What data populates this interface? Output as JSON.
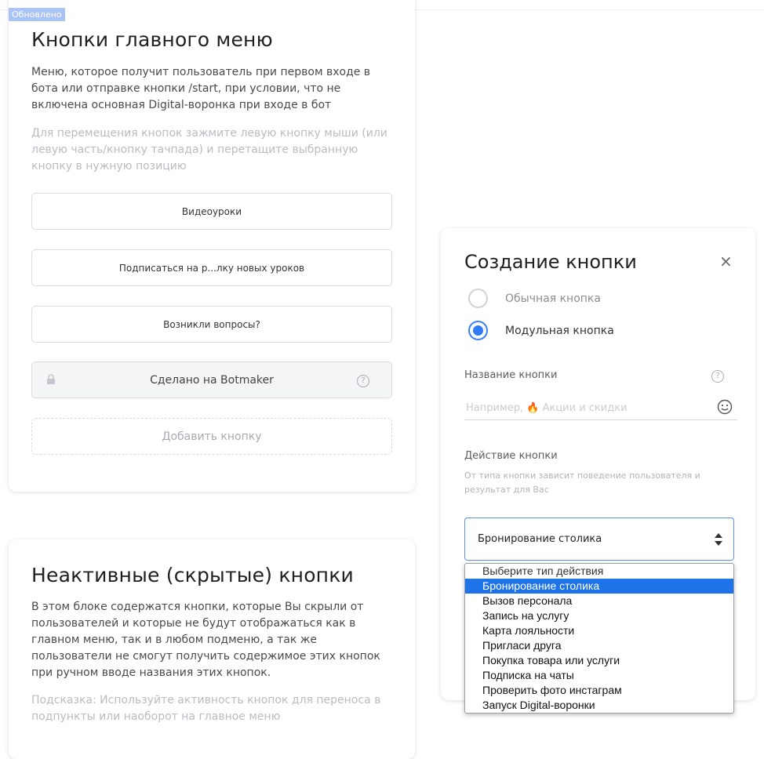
{
  "main_menu": {
    "badge": "Обновлено",
    "title": "Кнопки главного меню",
    "description": "Меню, которое получит пользователь при первом входе в бота или отправке кнопки /start, при условии, что не включена основная Digital-воронка при входе в бот",
    "hint": "Для перемещения кнопок зажмите левую кнопку мыши (или левую часть/кнопку тачпада) и перетащите выбранную кнопку в нужную позицию",
    "buttons": [
      {
        "label": "Видеоуроки"
      },
      {
        "label": "Подписаться на р...лку новых уроков"
      },
      {
        "label": "Возникли вопросы?"
      }
    ],
    "locked_button": {
      "label": "Сделано на Botmaker",
      "help": "?"
    },
    "add_button": "Добавить кнопку"
  },
  "inactive": {
    "title": "Неактивные (скрытые) кнопки",
    "description": "В этом блоке содержатся кнопки, которые Вы скрыли от пользователей и которые не будут отображаться как в главном меню, так и в любом подменю, а так же пользователи не смогут получить содержимое этих кнопок при ручном вводе названия этих кнопок.",
    "hint": "Подсказка: Используйте активность кнопок для переноса в подпункты или наоборот на главное меню"
  },
  "modal": {
    "title": "Создание кнопки",
    "close": "×",
    "radio_regular": "Обычная кнопка",
    "radio_modular": "Модульная кнопка",
    "selected_type": "modular",
    "name_label": "Название кнопки",
    "name_help": "?",
    "name_placeholder": "Например, 🔥 Акции и скидки",
    "action_label": "Действие кнопки",
    "action_sub": "От типа кнопки зависит поведение пользователя и результат для Вас",
    "selected_action": "Бронирование столика",
    "accent_color": "#2f7bf5"
  },
  "dropdown": {
    "options": [
      "Выберите тип действия",
      "Бронирование столика",
      "Вызов персонала",
      "Запись на услугу",
      "Карта лояльности",
      "Пригласи друга",
      "Покупка товара или услуги",
      "Подписка на чаты",
      "Проверить фото инстаграм",
      "Запуск Digital-воронки"
    ],
    "selected_index": 1,
    "highlight_color": "#1e73e8"
  }
}
